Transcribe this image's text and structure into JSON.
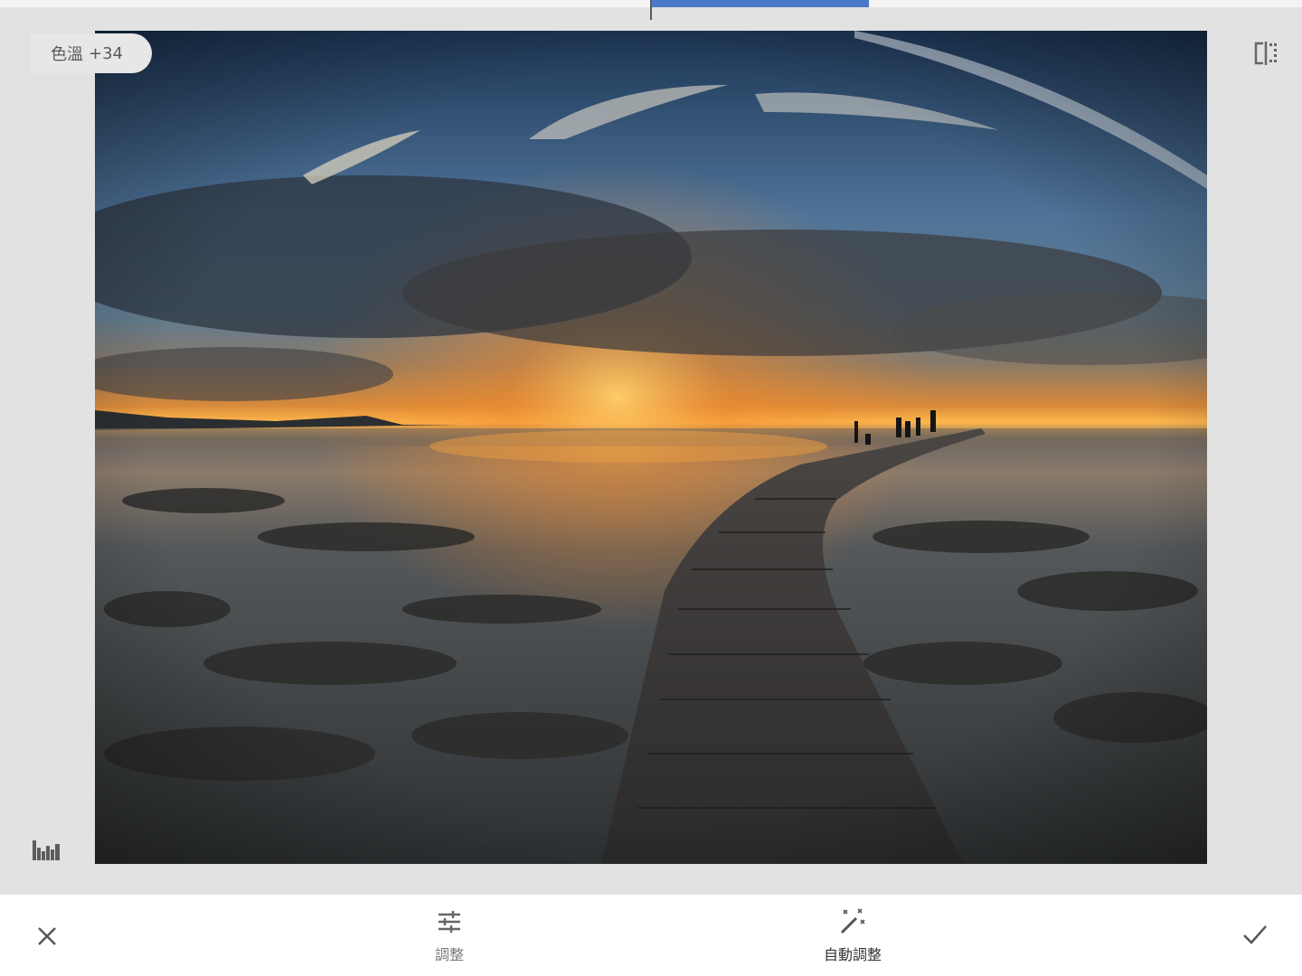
{
  "top_slider": {
    "value_fraction": 0.34
  },
  "value_badge": {
    "label": "色溫",
    "value": "+34"
  },
  "photo": {
    "subject": "sunset-pier-photo",
    "colors": {
      "sky_top": "#1f3a5c",
      "sky_mid": "#5b7fa6",
      "sun": "#ffb24a",
      "water": "#3c4648"
    }
  },
  "icons": {
    "compare": "compare-icon",
    "histogram": "histogram-icon",
    "cancel": "close-icon",
    "apply": "check-icon",
    "adjust": "sliders-icon",
    "auto": "magic-wand-icon"
  },
  "toolbar": {
    "adjust_label": "調整",
    "auto_label": "自動調整"
  },
  "colors": {
    "accent": "#4a79c9",
    "background": "#e2e2e2",
    "bar": "#ffffff"
  }
}
